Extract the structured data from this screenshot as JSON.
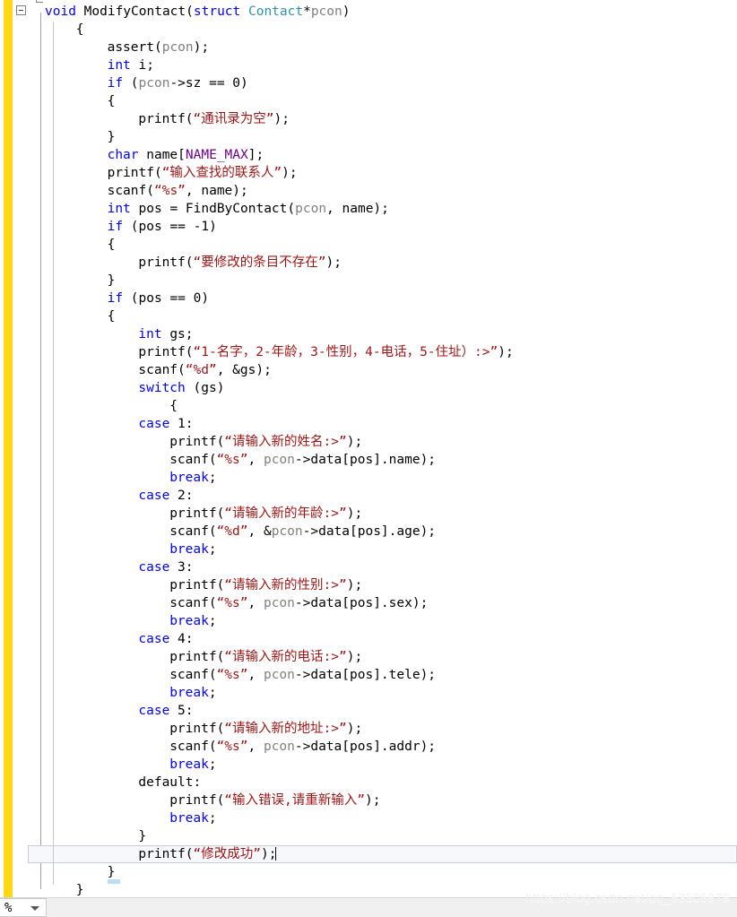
{
  "window": {
    "app": "visual-studio-code-editor",
    "language": "C"
  },
  "gutter": {
    "collapse_state": "expanded",
    "change_bar_color": "#ffd814"
  },
  "colors": {
    "keyword": "#0000ff",
    "type": "#2b91af",
    "string": "#a31515",
    "macro": "#6f008a",
    "parameter": "#808080",
    "plain": "#000000",
    "current_line_bg": "#f7f8fc",
    "current_line_border": "#c5cdd8",
    "brace_match": "#b9e0f2"
  },
  "status_bar": {
    "zoom_value": "%",
    "zoom_dropdown_icon": "chevron-down-icon"
  },
  "watermark": {
    "text": "https://blog.csdn.net/qq_53505979"
  },
  "code": {
    "lines": [
      {
        "indent": 0,
        "tokens": [
          {
            "t": "void ",
            "c": "kw"
          },
          {
            "t": "ModifyContact(",
            "c": "pln"
          },
          {
            "t": "struct ",
            "c": "kw"
          },
          {
            "t": "Contact",
            "c": "typ"
          },
          {
            "t": "*",
            "c": "pln"
          },
          {
            "t": "pcon",
            "c": "prm"
          },
          {
            "t": ")",
            "c": "pln"
          }
        ]
      },
      {
        "indent": 1,
        "tokens": [
          {
            "t": "{",
            "c": "pln"
          }
        ]
      },
      {
        "indent": 2,
        "tokens": [
          {
            "t": "assert",
            "c": "pln"
          },
          {
            "t": "(",
            "c": "pln"
          },
          {
            "t": "pcon",
            "c": "prm"
          },
          {
            "t": ");",
            "c": "pln"
          }
        ]
      },
      {
        "indent": 2,
        "tokens": [
          {
            "t": "int",
            "c": "kw"
          },
          {
            "t": " i;",
            "c": "pln"
          }
        ]
      },
      {
        "indent": 2,
        "tokens": [
          {
            "t": "if",
            "c": "kw"
          },
          {
            "t": " (",
            "c": "pln"
          },
          {
            "t": "pcon",
            "c": "prm"
          },
          {
            "t": "->sz == 0)",
            "c": "pln"
          }
        ]
      },
      {
        "indent": 2,
        "tokens": [
          {
            "t": "{",
            "c": "pln"
          }
        ]
      },
      {
        "indent": 3,
        "tokens": [
          {
            "t": "printf(",
            "c": "pln"
          },
          {
            "t": "“通讯录为空”",
            "c": "str"
          },
          {
            "t": ");",
            "c": "pln"
          }
        ]
      },
      {
        "indent": 2,
        "tokens": [
          {
            "t": "}",
            "c": "pln"
          }
        ]
      },
      {
        "indent": 2,
        "tokens": [
          {
            "t": "char",
            "c": "kw"
          },
          {
            "t": " name[",
            "c": "pln"
          },
          {
            "t": "NAME_MAX",
            "c": "mac"
          },
          {
            "t": "];",
            "c": "pln"
          }
        ]
      },
      {
        "indent": 2,
        "tokens": [
          {
            "t": "printf(",
            "c": "pln"
          },
          {
            "t": "“输入查找的联系人”",
            "c": "str"
          },
          {
            "t": ");",
            "c": "pln"
          }
        ]
      },
      {
        "indent": 2,
        "tokens": [
          {
            "t": "scanf(",
            "c": "pln"
          },
          {
            "t": "“%s”",
            "c": "str"
          },
          {
            "t": ", name);",
            "c": "pln"
          }
        ]
      },
      {
        "indent": 2,
        "tokens": [
          {
            "t": "int",
            "c": "kw"
          },
          {
            "t": " pos = FindByContact(",
            "c": "pln"
          },
          {
            "t": "pcon",
            "c": "prm"
          },
          {
            "t": ", name);",
            "c": "pln"
          }
        ]
      },
      {
        "indent": 2,
        "tokens": [
          {
            "t": "if",
            "c": "kw"
          },
          {
            "t": " (pos == -1)",
            "c": "pln"
          }
        ]
      },
      {
        "indent": 2,
        "tokens": [
          {
            "t": "{",
            "c": "pln"
          }
        ]
      },
      {
        "indent": 3,
        "tokens": [
          {
            "t": "printf(",
            "c": "pln"
          },
          {
            "t": "“要修改的条目不存在”",
            "c": "str"
          },
          {
            "t": ");",
            "c": "pln"
          }
        ]
      },
      {
        "indent": 2,
        "tokens": [
          {
            "t": "}",
            "c": "pln"
          }
        ]
      },
      {
        "indent": 2,
        "tokens": [
          {
            "t": "if",
            "c": "kw"
          },
          {
            "t": " (pos == 0)",
            "c": "pln"
          }
        ]
      },
      {
        "indent": 2,
        "tokens": [
          {
            "t": "{",
            "c": "pln"
          }
        ]
      },
      {
        "indent": 3,
        "tokens": [
          {
            "t": "int",
            "c": "kw"
          },
          {
            "t": " gs;",
            "c": "pln"
          }
        ]
      },
      {
        "indent": 3,
        "tokens": [
          {
            "t": "printf(",
            "c": "pln"
          },
          {
            "t": "“1-名字，2-年龄，3-性别，4-电话，5-住址）:>”",
            "c": "str"
          },
          {
            "t": ");",
            "c": "pln"
          }
        ]
      },
      {
        "indent": 3,
        "tokens": [
          {
            "t": "scanf(",
            "c": "pln"
          },
          {
            "t": "“%d”",
            "c": "str"
          },
          {
            "t": ", &gs);",
            "c": "pln"
          }
        ]
      },
      {
        "indent": 3,
        "tokens": [
          {
            "t": "switch",
            "c": "kw"
          },
          {
            "t": " (gs)",
            "c": "pln"
          }
        ]
      },
      {
        "indent": 4,
        "tokens": [
          {
            "t": "{",
            "c": "pln"
          }
        ]
      },
      {
        "indent": 3,
        "tokens": [
          {
            "t": "case",
            "c": "kw"
          },
          {
            "t": " 1:",
            "c": "pln"
          }
        ]
      },
      {
        "indent": 4,
        "tokens": [
          {
            "t": "printf(",
            "c": "pln"
          },
          {
            "t": "“请输入新的姓名:>”",
            "c": "str"
          },
          {
            "t": ");",
            "c": "pln"
          }
        ]
      },
      {
        "indent": 4,
        "tokens": [
          {
            "t": "scanf(",
            "c": "pln"
          },
          {
            "t": "“%s”",
            "c": "str"
          },
          {
            "t": ", ",
            "c": "pln"
          },
          {
            "t": "pcon",
            "c": "prm"
          },
          {
            "t": "->data[pos].name);",
            "c": "pln"
          }
        ]
      },
      {
        "indent": 4,
        "tokens": [
          {
            "t": "break",
            "c": "kw"
          },
          {
            "t": ";",
            "c": "pln"
          }
        ]
      },
      {
        "indent": 3,
        "tokens": [
          {
            "t": "case",
            "c": "kw"
          },
          {
            "t": " 2:",
            "c": "pln"
          }
        ]
      },
      {
        "indent": 4,
        "tokens": [
          {
            "t": "printf(",
            "c": "pln"
          },
          {
            "t": "“请输入新的年龄:>”",
            "c": "str"
          },
          {
            "t": ");",
            "c": "pln"
          }
        ]
      },
      {
        "indent": 4,
        "tokens": [
          {
            "t": "scanf(",
            "c": "pln"
          },
          {
            "t": "“%d”",
            "c": "str"
          },
          {
            "t": ", &",
            "c": "pln"
          },
          {
            "t": "pcon",
            "c": "prm"
          },
          {
            "t": "->data[pos].age);",
            "c": "pln"
          }
        ]
      },
      {
        "indent": 4,
        "tokens": [
          {
            "t": "break",
            "c": "kw"
          },
          {
            "t": ";",
            "c": "pln"
          }
        ]
      },
      {
        "indent": 3,
        "tokens": [
          {
            "t": "case",
            "c": "kw"
          },
          {
            "t": " 3:",
            "c": "pln"
          }
        ]
      },
      {
        "indent": 4,
        "tokens": [
          {
            "t": "printf(",
            "c": "pln"
          },
          {
            "t": "“请输入新的性别:>”",
            "c": "str"
          },
          {
            "t": ");",
            "c": "pln"
          }
        ]
      },
      {
        "indent": 4,
        "tokens": [
          {
            "t": "scanf(",
            "c": "pln"
          },
          {
            "t": "“%s”",
            "c": "str"
          },
          {
            "t": ", ",
            "c": "pln"
          },
          {
            "t": "pcon",
            "c": "prm"
          },
          {
            "t": "->data[pos].sex);",
            "c": "pln"
          }
        ]
      },
      {
        "indent": 4,
        "tokens": [
          {
            "t": "break",
            "c": "kw"
          },
          {
            "t": ";",
            "c": "pln"
          }
        ]
      },
      {
        "indent": 3,
        "tokens": [
          {
            "t": "case",
            "c": "kw"
          },
          {
            "t": " 4:",
            "c": "pln"
          }
        ]
      },
      {
        "indent": 4,
        "tokens": [
          {
            "t": "printf(",
            "c": "pln"
          },
          {
            "t": "“请输入新的电话:>”",
            "c": "str"
          },
          {
            "t": ");",
            "c": "pln"
          }
        ]
      },
      {
        "indent": 4,
        "tokens": [
          {
            "t": "scanf(",
            "c": "pln"
          },
          {
            "t": "“%s”",
            "c": "str"
          },
          {
            "t": ", ",
            "c": "pln"
          },
          {
            "t": "pcon",
            "c": "prm"
          },
          {
            "t": "->data[pos].tele);",
            "c": "pln"
          }
        ]
      },
      {
        "indent": 4,
        "tokens": [
          {
            "t": "break",
            "c": "kw"
          },
          {
            "t": ";",
            "c": "pln"
          }
        ]
      },
      {
        "indent": 3,
        "tokens": [
          {
            "t": "case",
            "c": "kw"
          },
          {
            "t": " 5:",
            "c": "pln"
          }
        ]
      },
      {
        "indent": 4,
        "tokens": [
          {
            "t": "printf(",
            "c": "pln"
          },
          {
            "t": "“请输入新的地址:>”",
            "c": "str"
          },
          {
            "t": ");",
            "c": "pln"
          }
        ]
      },
      {
        "indent": 4,
        "tokens": [
          {
            "t": "scanf(",
            "c": "pln"
          },
          {
            "t": "“%s”",
            "c": "str"
          },
          {
            "t": ", ",
            "c": "pln"
          },
          {
            "t": "pcon",
            "c": "prm"
          },
          {
            "t": "->data[pos].addr);",
            "c": "pln"
          }
        ]
      },
      {
        "indent": 4,
        "tokens": [
          {
            "t": "break",
            "c": "kw"
          },
          {
            "t": ";",
            "c": "pln"
          }
        ]
      },
      {
        "indent": 3,
        "tokens": [
          {
            "t": "default:",
            "c": "pln"
          }
        ]
      },
      {
        "indent": 4,
        "tokens": [
          {
            "t": "printf(",
            "c": "pln"
          },
          {
            "t": "“输入错误,请重新输入”",
            "c": "str"
          },
          {
            "t": ");",
            "c": "pln"
          }
        ]
      },
      {
        "indent": 4,
        "tokens": [
          {
            "t": "break",
            "c": "kw"
          },
          {
            "t": ";",
            "c": "pln"
          }
        ]
      },
      {
        "indent": 3,
        "tokens": [
          {
            "t": "}",
            "c": "pln"
          }
        ]
      },
      {
        "indent": 3,
        "tokens": [
          {
            "t": "printf(",
            "c": "pln"
          },
          {
            "t": "“修改成功”",
            "c": "str"
          },
          {
            "t": ");",
            "c": "pln"
          }
        ],
        "current": true
      },
      {
        "indent": 2,
        "tokens": [
          {
            "t": "}",
            "c": "pln"
          }
        ],
        "brace_match": true
      },
      {
        "indent": 1,
        "tokens": [
          {
            "t": "}",
            "c": "pln"
          }
        ]
      }
    ]
  }
}
